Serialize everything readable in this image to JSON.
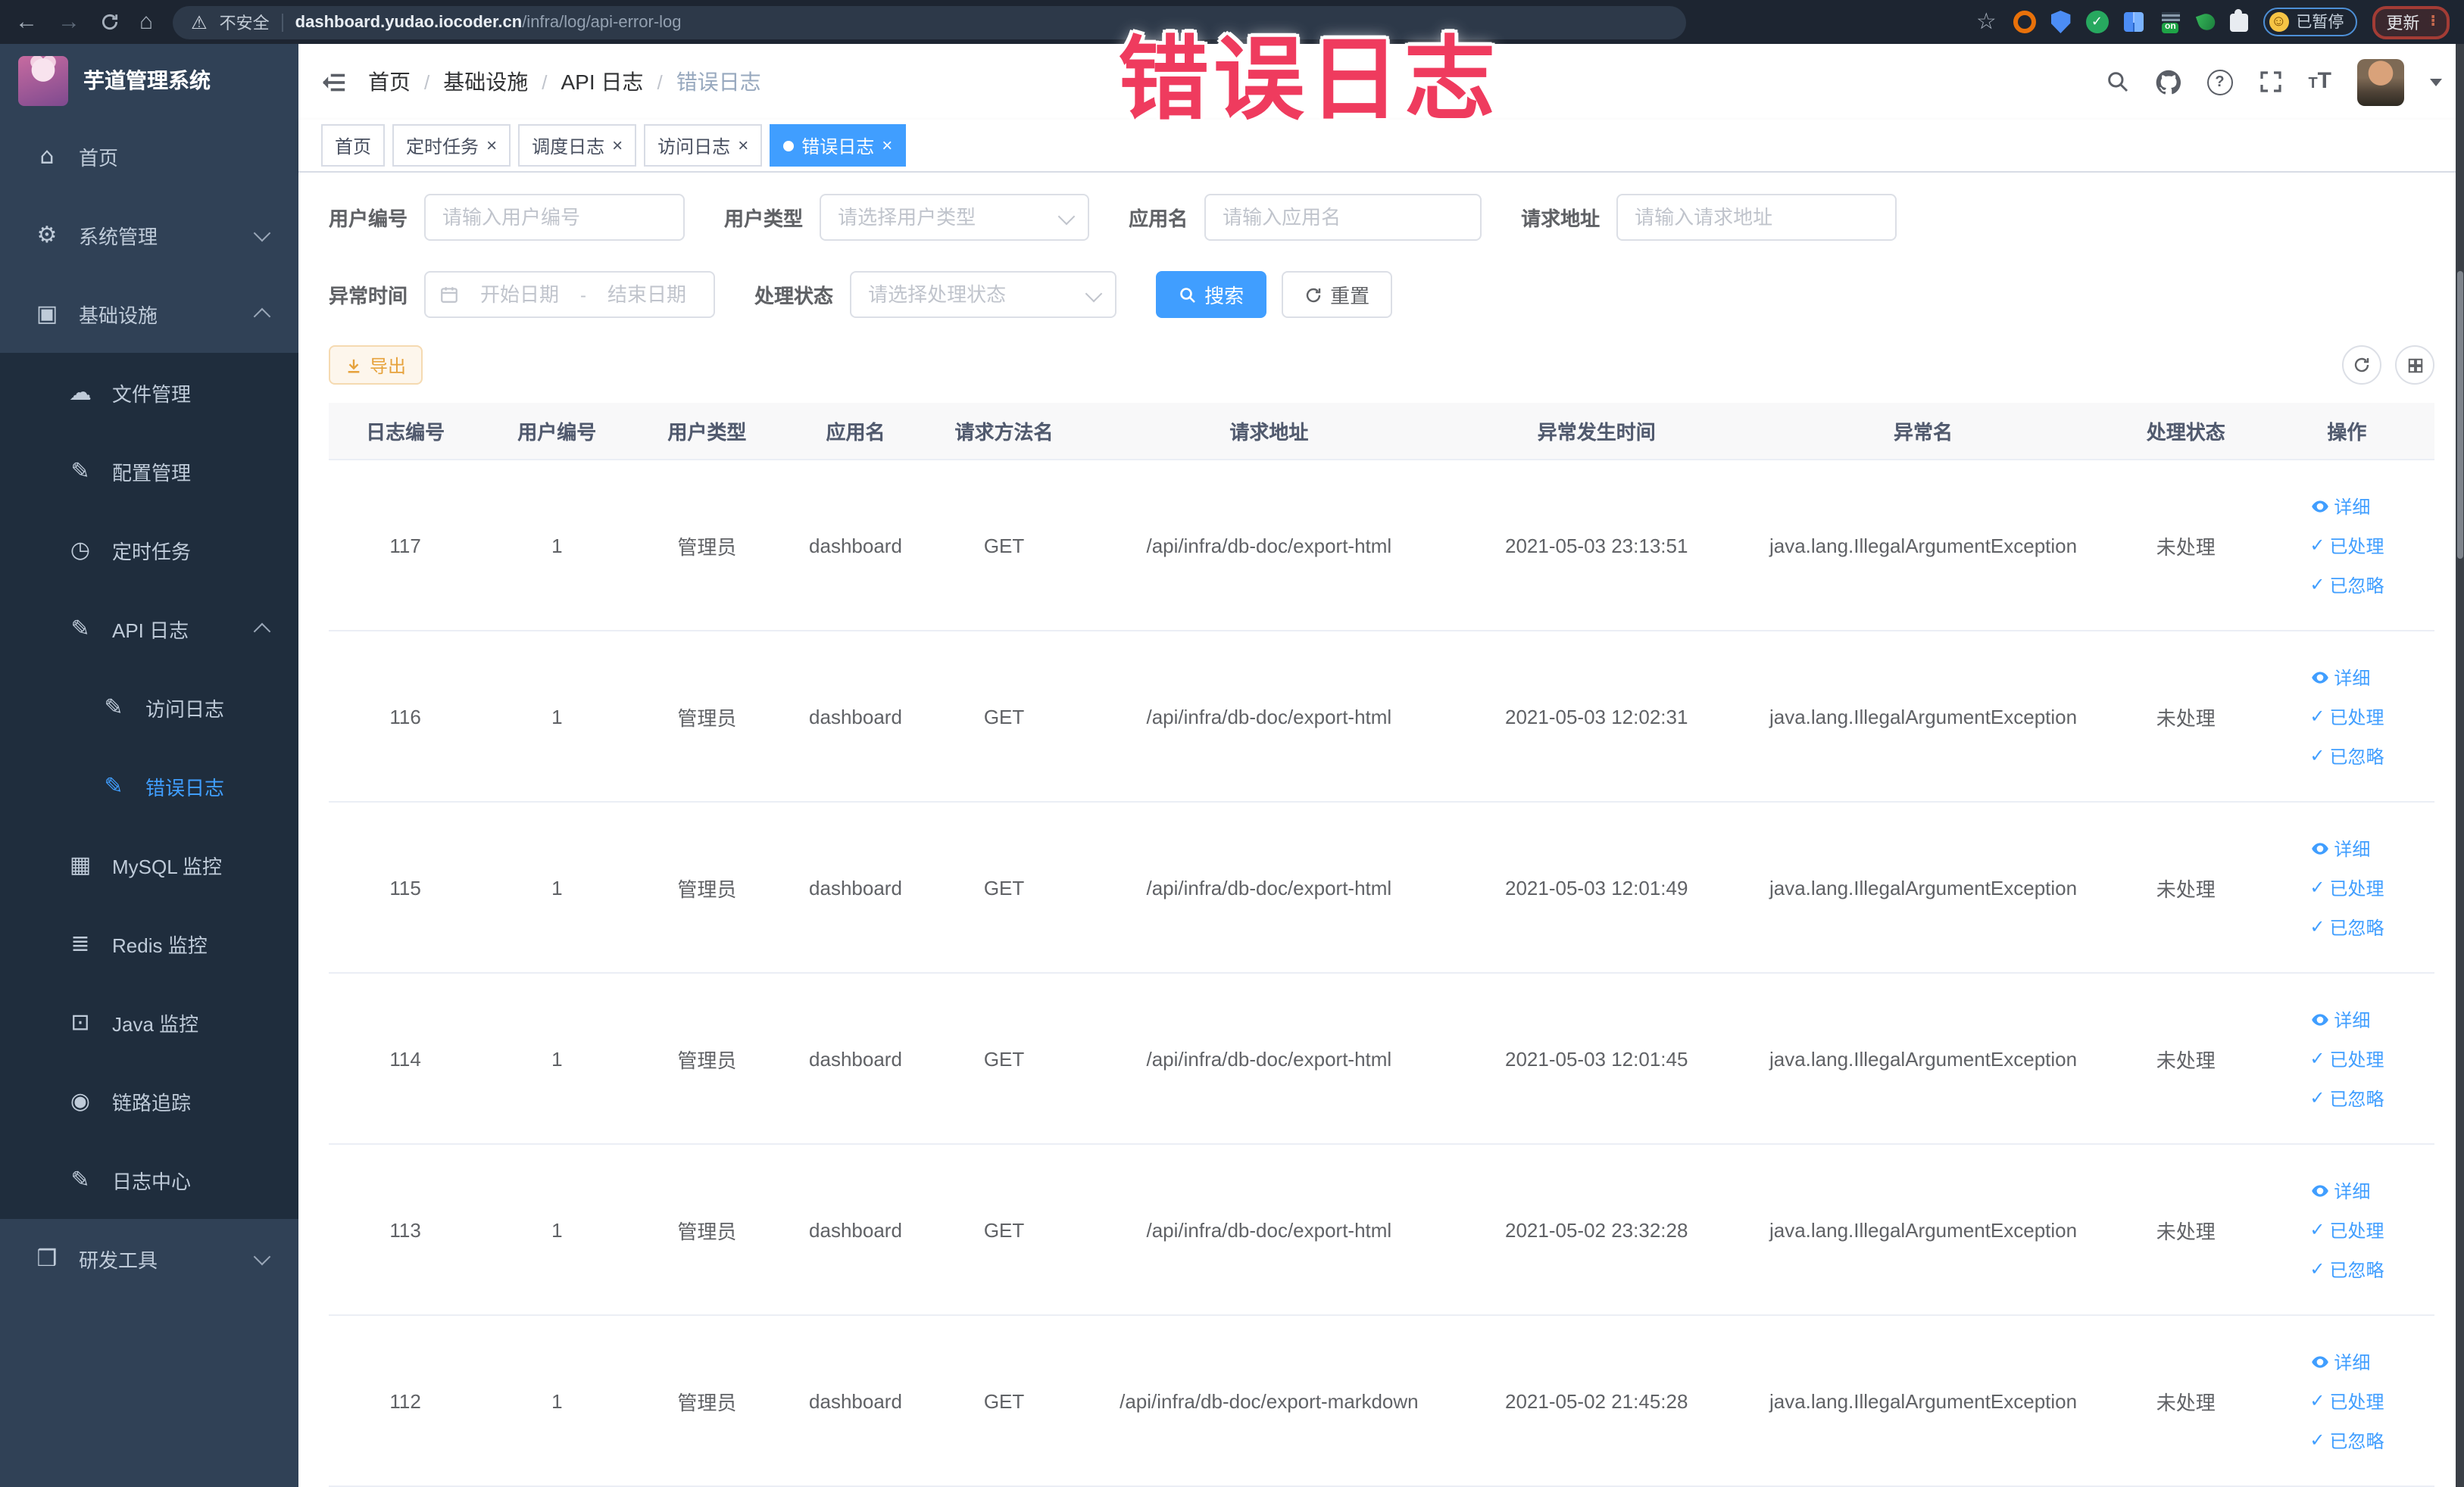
{
  "browser": {
    "security_label": "不安全",
    "url_domain": "dashboard.yudao.iocoder.cn",
    "url_path": "/infra/log/api-error-log",
    "paused_badge": "已暂停",
    "update_button": "更新",
    "extension_on_badge": "on"
  },
  "annotation": {
    "text": "错误日志",
    "color": "#ef3b5e"
  },
  "sidebar": {
    "logo_title": "芋道管理系统",
    "items": [
      {
        "id": "home",
        "label": "首页",
        "icon": "home-icon",
        "glyph": "⌂",
        "level": 0,
        "arrow": null,
        "active": false
      },
      {
        "id": "system-mgmt",
        "label": "系统管理",
        "icon": "gear-icon",
        "glyph": "⚙",
        "level": 0,
        "arrow": "down",
        "active": false
      },
      {
        "id": "infrastructure",
        "label": "基础设施",
        "icon": "monitor-icon",
        "glyph": "▣",
        "level": 0,
        "arrow": "up",
        "active": false
      },
      {
        "id": "file-mgmt",
        "label": "文件管理",
        "icon": "cloud-upload-icon",
        "glyph": "☁",
        "level": 1,
        "arrow": null,
        "active": false
      },
      {
        "id": "config-mgmt",
        "label": "配置管理",
        "icon": "edit-icon",
        "glyph": "✎",
        "level": 1,
        "arrow": null,
        "active": false
      },
      {
        "id": "scheduled-jobs",
        "label": "定时任务",
        "icon": "timer-icon",
        "glyph": "◷",
        "level": 1,
        "arrow": null,
        "active": false
      },
      {
        "id": "api-log",
        "label": "API 日志",
        "icon": "log-edit-icon",
        "glyph": "✎",
        "level": 1,
        "arrow": "up",
        "active": false
      },
      {
        "id": "access-log",
        "label": "访问日志",
        "icon": "log-edit-icon",
        "glyph": "✎",
        "level": 2,
        "arrow": null,
        "active": false
      },
      {
        "id": "error-log",
        "label": "错误日志",
        "icon": "log-edit-icon",
        "glyph": "✎",
        "level": 2,
        "arrow": null,
        "active": true
      },
      {
        "id": "mysql-monitor",
        "label": "MySQL 监控",
        "icon": "mysql-icon",
        "glyph": "▦",
        "level": 1,
        "arrow": null,
        "active": false
      },
      {
        "id": "redis-monitor",
        "label": "Redis 监控",
        "icon": "layers-icon",
        "glyph": "≣",
        "level": 1,
        "arrow": null,
        "active": false
      },
      {
        "id": "java-monitor",
        "label": "Java 监控",
        "icon": "java-monitor-icon",
        "glyph": "⊡",
        "level": 1,
        "arrow": null,
        "active": false
      },
      {
        "id": "trace",
        "label": "链路追踪",
        "icon": "eye-icon",
        "glyph": "◉",
        "level": 1,
        "arrow": null,
        "active": false
      },
      {
        "id": "log-center",
        "label": "日志中心",
        "icon": "log-edit-icon",
        "glyph": "✎",
        "level": 1,
        "arrow": null,
        "active": false
      },
      {
        "id": "dev-tools",
        "label": "研发工具",
        "icon": "toolbox-icon",
        "glyph": "❒",
        "level": 0,
        "arrow": "down",
        "active": false
      }
    ]
  },
  "header": {
    "breadcrumb": [
      "首页",
      "基础设施",
      "API 日志",
      "错误日志"
    ]
  },
  "tabs": [
    {
      "label": "首页",
      "closable": false,
      "active": false
    },
    {
      "label": "定时任务",
      "closable": true,
      "active": false
    },
    {
      "label": "调度日志",
      "closable": true,
      "active": false
    },
    {
      "label": "访问日志",
      "closable": true,
      "active": false
    },
    {
      "label": "错误日志",
      "closable": true,
      "active": true
    }
  ],
  "filters": {
    "user_id": {
      "label": "用户编号",
      "placeholder": "请输入用户编号"
    },
    "user_type": {
      "label": "用户类型",
      "placeholder": "请选择用户类型"
    },
    "app_name": {
      "label": "应用名",
      "placeholder": "请输入应用名"
    },
    "request_url": {
      "label": "请求地址",
      "placeholder": "请输入请求地址"
    },
    "exception_time": {
      "label": "异常时间",
      "start_placeholder": "开始日期",
      "separator": "-",
      "end_placeholder": "结束日期"
    },
    "process_status": {
      "label": "处理状态",
      "placeholder": "请选择处理状态"
    },
    "search_label": "搜索",
    "reset_label": "重置"
  },
  "toolbar": {
    "export_label": "导出"
  },
  "table": {
    "columns": [
      "日志编号",
      "用户编号",
      "用户类型",
      "应用名",
      "请求方法名",
      "请求地址",
      "异常发生时间",
      "异常名",
      "处理状态",
      "操作"
    ],
    "actions": [
      {
        "label": "详细",
        "icon": "eye"
      },
      {
        "label": "已处理",
        "icon": "check"
      },
      {
        "label": "已忽略",
        "icon": "check"
      }
    ],
    "rows": [
      [
        "117",
        "1",
        "管理员",
        "dashboard",
        "GET",
        "/api/infra/db-doc/export-html",
        "2021-05-03 23:13:51",
        "java.lang.IllegalArgumentException",
        "未处理"
      ],
      [
        "116",
        "1",
        "管理员",
        "dashboard",
        "GET",
        "/api/infra/db-doc/export-html",
        "2021-05-03 12:02:31",
        "java.lang.IllegalArgumentException",
        "未处理"
      ],
      [
        "115",
        "1",
        "管理员",
        "dashboard",
        "GET",
        "/api/infra/db-doc/export-html",
        "2021-05-03 12:01:49",
        "java.lang.IllegalArgumentException",
        "未处理"
      ],
      [
        "114",
        "1",
        "管理员",
        "dashboard",
        "GET",
        "/api/infra/db-doc/export-html",
        "2021-05-03 12:01:45",
        "java.lang.IllegalArgumentException",
        "未处理"
      ],
      [
        "113",
        "1",
        "管理员",
        "dashboard",
        "GET",
        "/api/infra/db-doc/export-html",
        "2021-05-02 23:32:28",
        "java.lang.IllegalArgumentException",
        "未处理"
      ],
      [
        "112",
        "1",
        "管理员",
        "dashboard",
        "GET",
        "/api/infra/db-doc/export-markdown",
        "2021-05-02 21:45:28",
        "java.lang.IllegalArgumentException",
        "未处理"
      ]
    ]
  },
  "colors": {
    "accent": "#409eff",
    "warning": "#e6a23c",
    "annotation": "#ef3b5e",
    "sidebar_bg": "#304156",
    "submenu_bg": "#1f2d3d"
  }
}
